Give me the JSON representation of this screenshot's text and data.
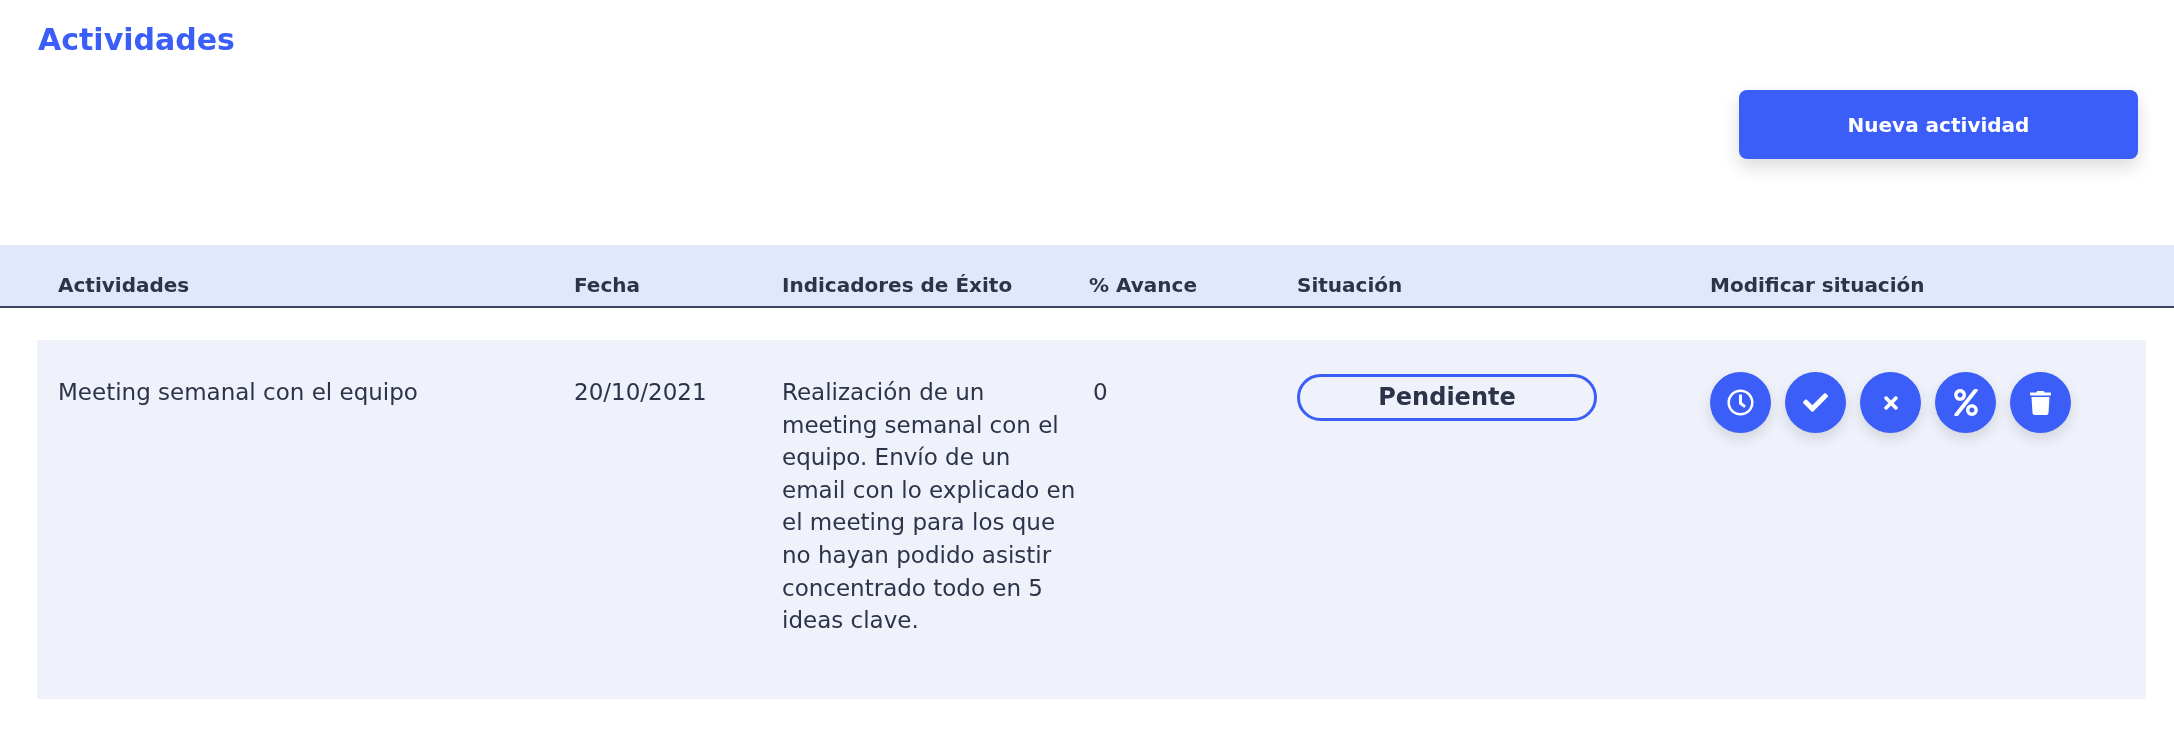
{
  "page": {
    "title": "Actividades"
  },
  "toolbar": {
    "new_button": "Nueva actividad"
  },
  "table": {
    "columns": [
      "Actividades",
      "Fecha",
      "Indicadores de Éxito",
      "% Avance",
      "Situación",
      "Modificar situación"
    ],
    "rows": [
      {
        "activity": "Meeting semanal con el equipo",
        "date": "20/10/2021",
        "indicators": "Realización de un meeting semanal con el equipo. Envío de un email con lo explicado en el meeting para los que no hayan podido asistir concentrado todo en 5 ideas clave.",
        "progress": "0",
        "status": "Pendiente"
      }
    ]
  }
}
